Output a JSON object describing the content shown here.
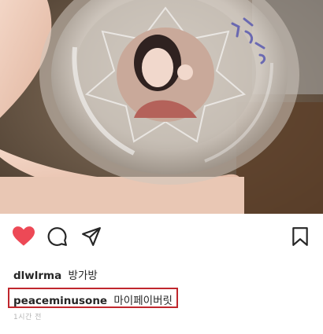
{
  "post": {
    "photo_caption_on_glass": "방가방",
    "actions": {
      "like_icon": "heart-filled-icon",
      "comment_icon": "comment-icon",
      "share_icon": "send-icon",
      "save_icon": "bookmark-icon",
      "like_color": "#ed4956"
    },
    "comments": [
      {
        "username": "dlwlrma",
        "text": "방가방"
      },
      {
        "username": "peaceminusone",
        "text": "마이페이버릿"
      }
    ],
    "highlight_color": "#c0272d",
    "timestamp": "1시간 전"
  }
}
